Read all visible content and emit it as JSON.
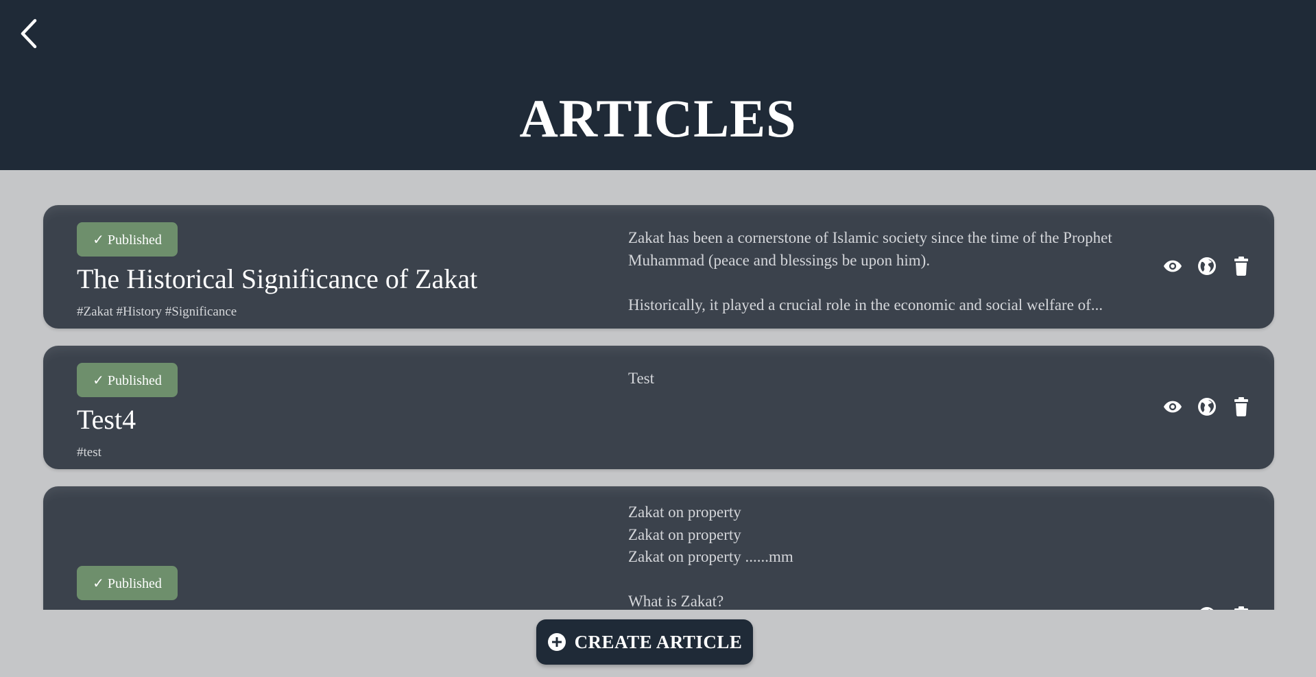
{
  "header": {
    "back_icon": "chevron-left-icon",
    "title": "ARTICLES",
    "background": "#1f2a37"
  },
  "articles": [
    {
      "status": "✓ Published",
      "title": "The Historical Significance of Zakat",
      "tags": "#Zakat #History #Significance",
      "excerpt": "Zakat has been a cornerstone of Islamic society since the time of the Prophet Muhammad (peace and blessings be upon him).\n\nHistorically, it played a crucial role in the economic and social welfare of...",
      "actions": [
        "eye-icon",
        "globe-icon",
        "trash-icon"
      ]
    },
    {
      "status": "✓ Published",
      "title": "Test4",
      "tags": "#test",
      "excerpt": "Test",
      "actions": [
        "eye-icon",
        "globe-icon",
        "trash-icon"
      ]
    },
    {
      "status": "✓ Published",
      "title": "",
      "tags": "",
      "excerpt": "Zakat on property\nZakat on property\nZakat on property ......mm\n\nWhat is Zakat?",
      "actions": [
        "eye-icon",
        "globe-icon",
        "trash-icon"
      ]
    }
  ],
  "create_button": {
    "label": "CREATE ARTICLE",
    "icon": "plus-circle-icon"
  },
  "colors": {
    "background": "#c5c6c8",
    "card": "#3b424c",
    "badge": "#6e8f6c"
  }
}
